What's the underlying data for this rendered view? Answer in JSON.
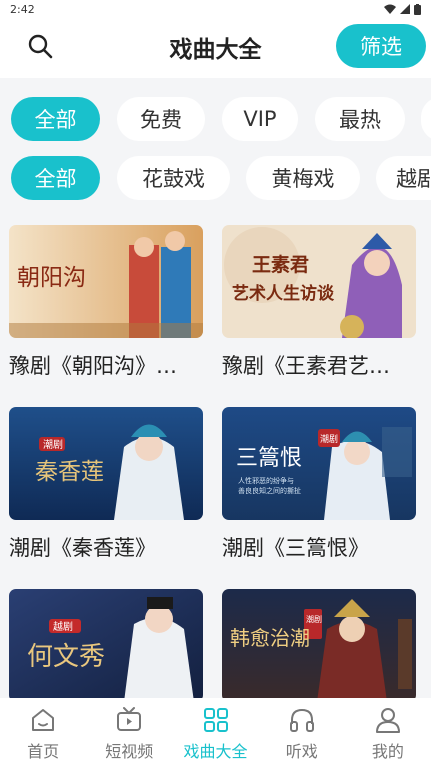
{
  "status_bar": {
    "time": "2:42"
  },
  "header": {
    "title": "戏曲大全",
    "filter_label": "筛选"
  },
  "filters_row1": [
    {
      "label": "全部",
      "active": true
    },
    {
      "label": "免费",
      "active": false
    },
    {
      "label": "VIP",
      "active": false
    },
    {
      "label": "最热",
      "active": false
    }
  ],
  "filters_row2": [
    {
      "label": "全部",
      "active": true
    },
    {
      "label": "花鼓戏",
      "active": false
    },
    {
      "label": "黄梅戏",
      "active": false
    },
    {
      "label": "越剧",
      "active": false
    }
  ],
  "videos": [
    {
      "title": "豫剧《朝阳沟》…",
      "thumb_text": "朝阳沟"
    },
    {
      "title": "豫剧《王素君艺…",
      "thumb_text_1": "王素君",
      "thumb_text_2": "艺术人生访谈"
    },
    {
      "title": "潮剧《秦香莲》",
      "thumb_badge": "潮剧",
      "thumb_text": "秦香莲"
    },
    {
      "title": "潮剧《三篙恨》",
      "thumb_badge": "潮剧",
      "thumb_text": "三篙恨",
      "thumb_sub_1": "人性邪恶的纷争与",
      "thumb_sub_2": "善良良知之间的撕扯"
    },
    {
      "title": "",
      "thumb_badge": "越剧",
      "thumb_text": "何文秀"
    },
    {
      "title": "",
      "thumb_badge": "潮剧",
      "thumb_text": "韩愈治潮"
    }
  ],
  "tabbar": [
    {
      "label": "首页",
      "icon": "home-icon",
      "active": false
    },
    {
      "label": "短视频",
      "icon": "tv-icon",
      "active": false
    },
    {
      "label": "戏曲大全",
      "icon": "grid-icon",
      "active": true
    },
    {
      "label": "听戏",
      "icon": "headphones-icon",
      "active": false
    },
    {
      "label": "我的",
      "icon": "user-icon",
      "active": false
    }
  ],
  "colors": {
    "accent": "#19c1cc",
    "background": "#f4f5f7"
  }
}
